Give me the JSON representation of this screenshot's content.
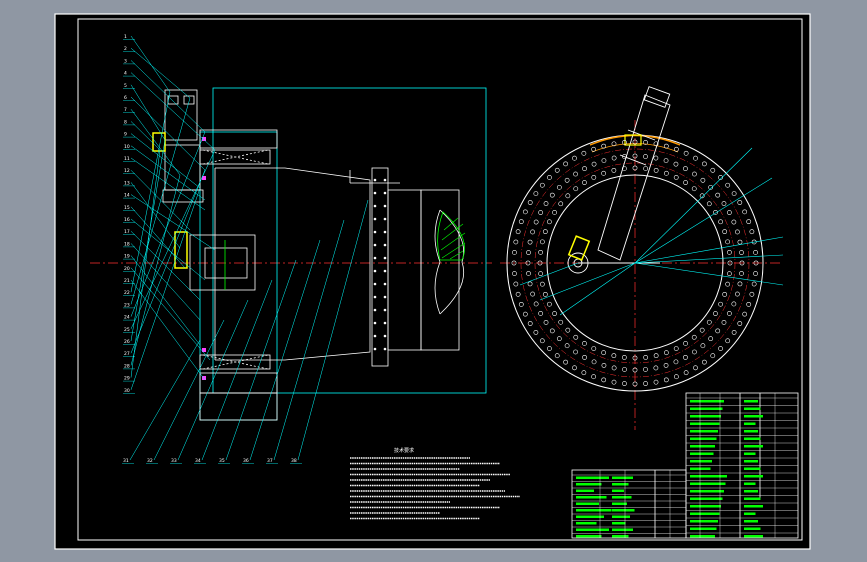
{
  "window": {
    "background": "#8f97a3"
  },
  "sheet": {
    "paper_color": "#000000",
    "frame_color": "#ffffff"
  },
  "colors": {
    "cyan": "#00ffff",
    "white": "#ffffff",
    "yellow": "#ffff00",
    "green": "#00ff00",
    "red": "#ff3030",
    "magenta": "#ff40ff",
    "orange": "#ff9900"
  },
  "drawing": {
    "left_view": "sectional view of rotary joint assembly",
    "right_view": "front view of ring flange with bolt pattern"
  },
  "balloons": [
    "1",
    "2",
    "3",
    "4",
    "5",
    "6",
    "7",
    "8",
    "9",
    "10",
    "11",
    "12",
    "13",
    "14",
    "15",
    "16",
    "17",
    "18",
    "19",
    "20",
    "21",
    "22",
    "23",
    "24",
    "25",
    "26",
    "27",
    "28",
    "29",
    "30",
    "31",
    "32",
    "33",
    "34",
    "35",
    "36",
    "37",
    "38"
  ],
  "notes_title": "技术要求",
  "title_block": {
    "cells": []
  }
}
